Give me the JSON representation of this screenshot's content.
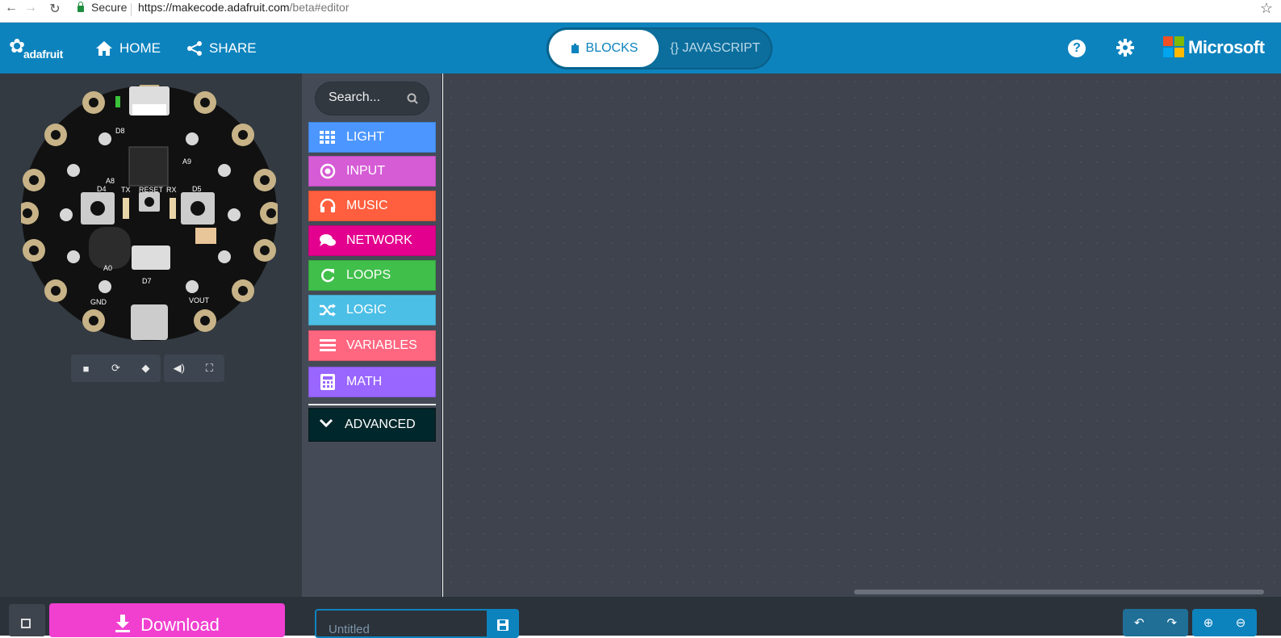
{
  "browser": {
    "security_label": "Secure",
    "url_host": "https://makecode.adafruit.com",
    "url_path": "/beta#editor"
  },
  "header": {
    "logo_text": "adafruit",
    "nav": [
      {
        "label": "HOME",
        "icon": "home-icon"
      },
      {
        "label": "SHARE",
        "icon": "share-icon"
      }
    ],
    "tabs": [
      {
        "label": "BLOCKS",
        "active": true
      },
      {
        "label": "{} JAVASCRIPT",
        "active": false
      }
    ],
    "brand_text": "Microsoft",
    "accent_color": "#0d83be"
  },
  "toolbox": {
    "search_placeholder": "Search...",
    "categories": [
      {
        "label": "LIGHT",
        "color": "#4c97ff",
        "icon": "grid-icon"
      },
      {
        "label": "INPUT",
        "color": "#d65cd6",
        "icon": "target-icon"
      },
      {
        "label": "MUSIC",
        "color": "#ff5f3e",
        "icon": "headphones-icon"
      },
      {
        "label": "NETWORK",
        "color": "#e4008e",
        "icon": "chat-icon"
      },
      {
        "label": "LOOPS",
        "color": "#40bf4a",
        "icon": "refresh-icon"
      },
      {
        "label": "LOGIC",
        "color": "#4cbfe6",
        "icon": "shuffle-icon"
      },
      {
        "label": "VARIABLES",
        "color": "#ff6680",
        "icon": "list-icon"
      },
      {
        "label": "MATH",
        "color": "#9966ff",
        "icon": "calculator-icon"
      }
    ],
    "advanced_label": "ADVANCED"
  },
  "simulator": {
    "controls": [
      "stop-icon",
      "restart-icon",
      "slow-motion-icon",
      "mute-icon",
      "fullscreen-icon"
    ]
  },
  "footer": {
    "download_label": "Download",
    "project_placeholder": "Untitled"
  }
}
